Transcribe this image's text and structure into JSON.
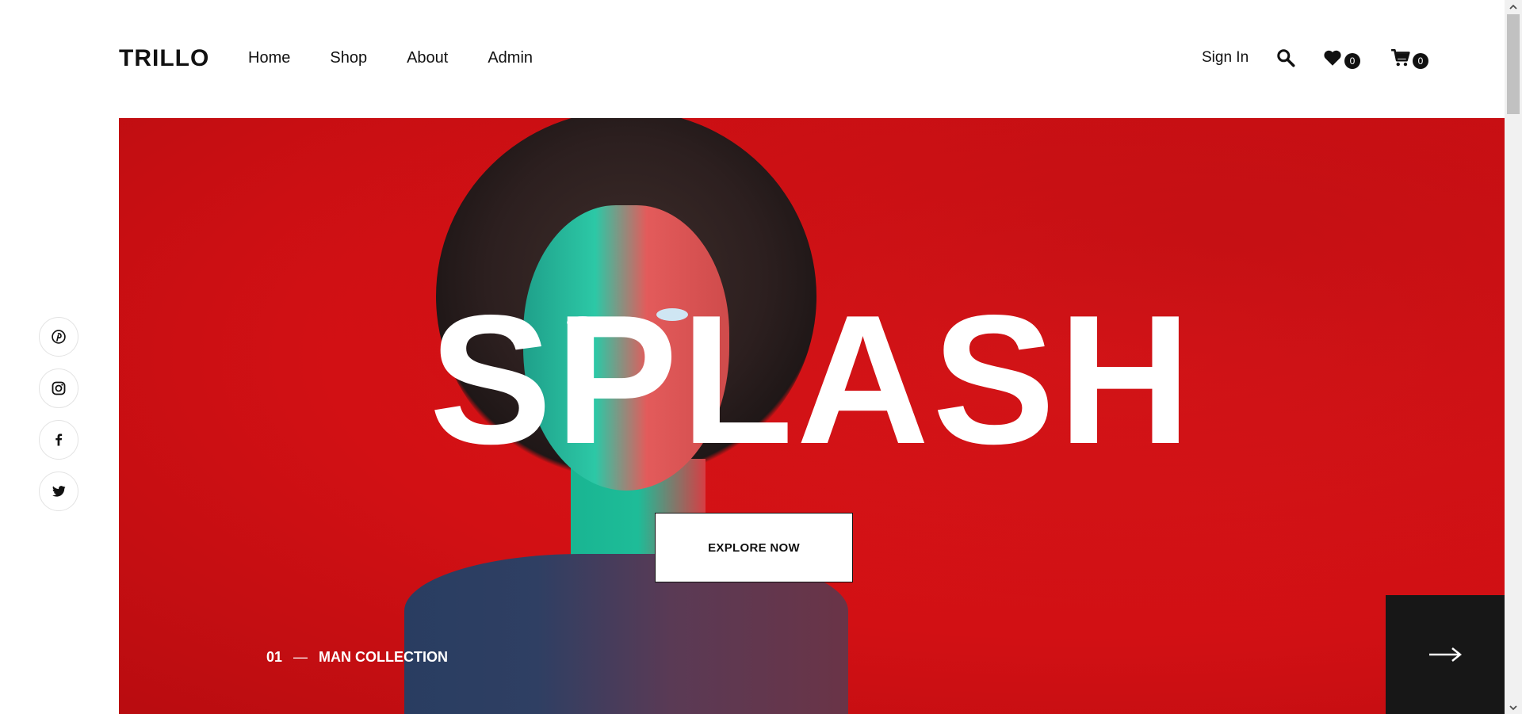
{
  "header": {
    "logo": "TRILLO",
    "nav": [
      {
        "label": "Home"
      },
      {
        "label": "Shop"
      },
      {
        "label": "About"
      },
      {
        "label": "Admin"
      }
    ],
    "sign_in": "Sign In",
    "icons": {
      "search": "search-icon",
      "wishlist": "heart-icon",
      "cart": "cart-icon"
    },
    "wishlist_count": "0",
    "cart_count": "0"
  },
  "social": [
    {
      "name": "pinterest-icon"
    },
    {
      "name": "instagram-icon"
    },
    {
      "name": "facebook-icon"
    },
    {
      "name": "twitter-icon"
    }
  ],
  "hero": {
    "title": "SPLASH",
    "cta": "EXPLORE NOW",
    "slide_number": "01",
    "slide_separator": "—",
    "slide_label": "MAN COLLECTION",
    "next_icon": "arrow-right-icon",
    "colors": {
      "background": "#d21014",
      "button_bg": "#ffffff",
      "next_bg": "#171717"
    }
  }
}
